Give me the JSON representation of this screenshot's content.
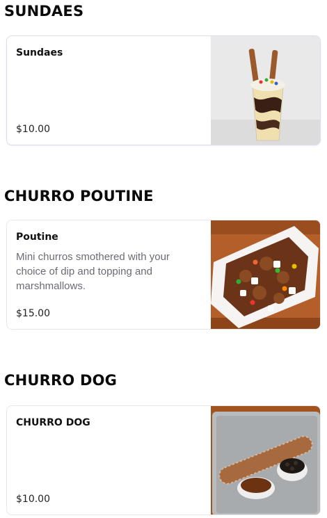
{
  "sections": [
    {
      "title": "SUNDAES",
      "items": [
        {
          "name": "Sundaes",
          "description": "",
          "price": "$10.00",
          "image_icon": "sundae-photo"
        }
      ]
    },
    {
      "title": "CHURRO POUTINE",
      "items": [
        {
          "name": "Poutine",
          "description": "Mini churros smothered with your choice of dip and topping and marshmallows.",
          "price": "$15.00",
          "image_icon": "poutine-photo"
        }
      ]
    },
    {
      "title": "CHURRO DOG",
      "items": [
        {
          "name": "CHURRO DOG",
          "description": "",
          "price": "$10.00",
          "image_icon": "churro-dog-photo"
        }
      ]
    }
  ]
}
